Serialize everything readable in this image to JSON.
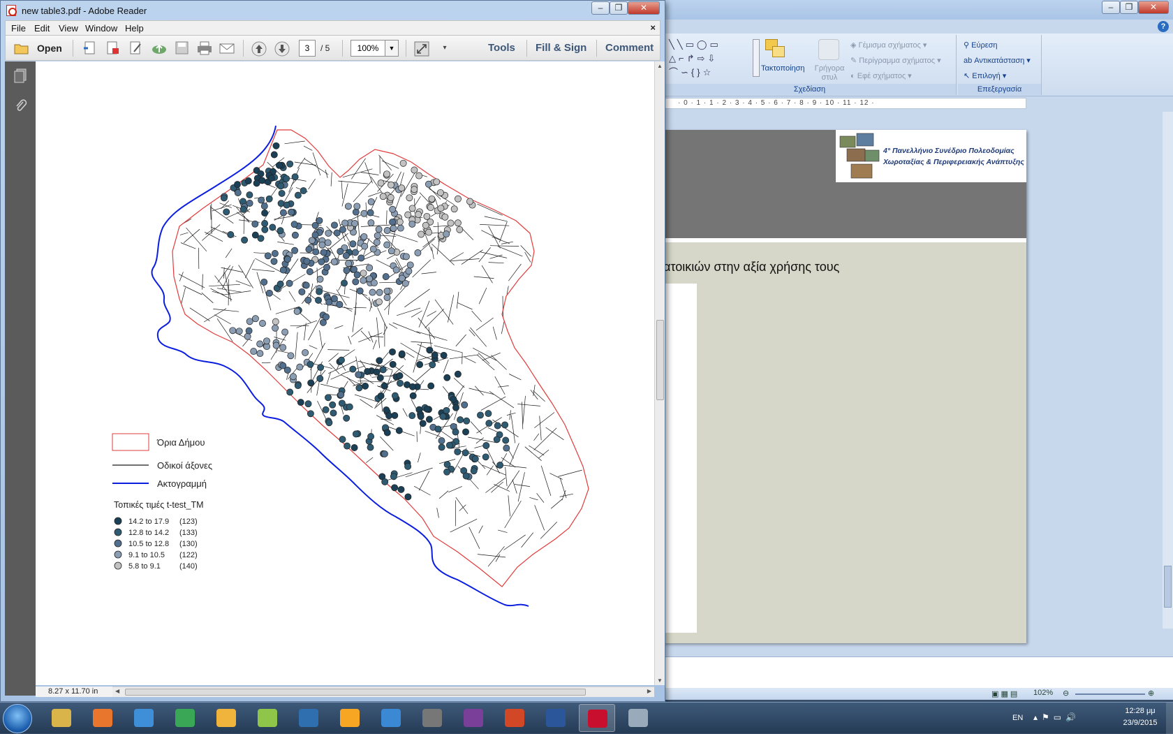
{
  "reader": {
    "title": "new table3.pdf - Adobe Reader",
    "menu": [
      "File",
      "Edit",
      "View",
      "Window",
      "Help"
    ],
    "toolbar": {
      "open_label": "Open",
      "page_current": "3",
      "page_total": "/ 5",
      "zoom": "100%",
      "tools_label": "Tools",
      "fill_sign_label": "Fill & Sign",
      "comment_label": "Comment"
    },
    "page_size": "8.27 x 11.70 in"
  },
  "map": {
    "legend": {
      "boundary_label": "Όρια Δήμου",
      "roads_label": "Οδικοί άξονες",
      "coast_label": "Ακτογραμμή",
      "values_title": "Τοπικές τιμές t-test_TM",
      "classes": [
        {
          "label": "14.2 to 17.9",
          "count": "(123)",
          "color": "#1b3f55"
        },
        {
          "label": "12.8 to 14.2",
          "count": "(133)",
          "color": "#2e5a72"
        },
        {
          "label": "10.5 to 12.8",
          "count": "(130)",
          "color": "#52708d"
        },
        {
          "label": "9.1 to 10.5",
          "count": "(122)",
          "color": "#8a9db3"
        },
        {
          "label": "5.8 to   9.1",
          "count": "(140)",
          "color": "#c2c2c2"
        }
      ]
    },
    "colors": {
      "boundary": "#e23b3b",
      "roads": "#1a1a1a",
      "coast": "#0b1ee0"
    }
  },
  "ppt": {
    "ribbon": {
      "arrange_label": "Τακτοποίηση",
      "quick_styles_label": "Γρήγορα στυλ",
      "shape_fill_label": "Γέμισμα σχήματος",
      "shape_outline_label": "Περίγραμμα σχήματος",
      "shape_effects_label": "Εφέ σχήματος",
      "drawing_group": "Σχεδίαση",
      "find_label": "Εύρεση",
      "replace_label": "Αντικατάσταση",
      "select_label": "Επιλογή",
      "editing_group": "Επεξεργασία"
    },
    "ruler": "· 0 · 1 · 1 · 2 · 3 · 4 · 5 · 6 · 7 · 8 · 9 · 10 · 11 · 12 ·",
    "slide": {
      "logo_line1": "4° Πανελλήνιο Συνέδριο Πολεοδομίας",
      "logo_line2": "Χωροταξίας & Περιφερειακής Ανάπτυξης",
      "title": "ατοικιών στην αξία χρήσης τους"
    },
    "zoom": "102%"
  },
  "taskbar": {
    "apps": [
      "explorer",
      "firefox",
      "safari",
      "chrome",
      "outlook",
      "files",
      "app",
      "media-player",
      "thunderbird",
      "gimp",
      "media-center",
      "powerpoint",
      "word",
      "acrobat",
      "notepad"
    ],
    "lang": "EN",
    "time": "12:28 μμ",
    "date": "23/9/2015"
  }
}
